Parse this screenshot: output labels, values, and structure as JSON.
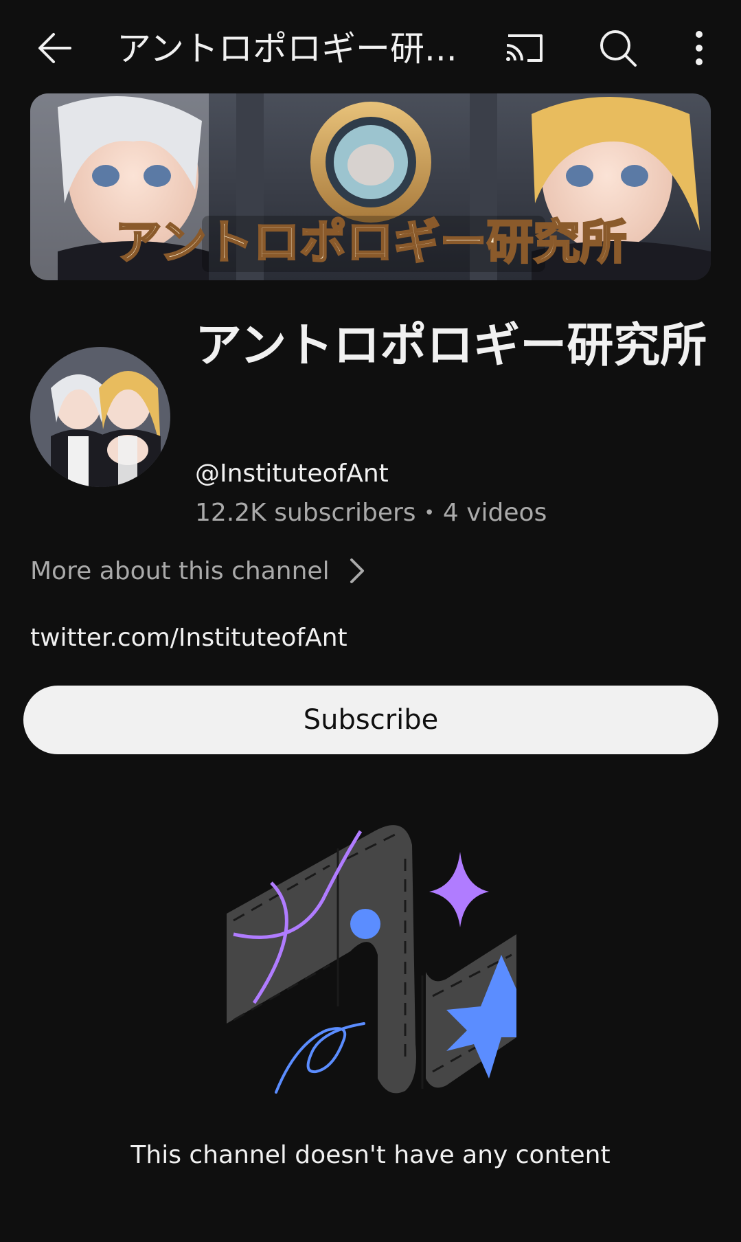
{
  "header": {
    "title": "アントロポロギー研...",
    "back_icon": "arrow-back-icon",
    "cast_icon": "cast-icon",
    "search_icon": "search-icon",
    "more_icon": "more-vertical-icon"
  },
  "banner": {
    "overlay_text": "アントロポロギー研究所"
  },
  "channel": {
    "name": "アントロポロギー研究所",
    "handle": "@InstituteofAnt",
    "subscribers": "12.2K subscribers",
    "separator": "•",
    "videos": "4 videos",
    "more_about": "More about this channel",
    "link": "twitter.com/InstituteofAnt"
  },
  "actions": {
    "subscribe_label": "Subscribe"
  },
  "empty_state": {
    "message": "This channel doesn't have any content"
  },
  "colors": {
    "background": "#0f0f0f",
    "text_primary": "#f1f1f1",
    "text_secondary": "#aaaaaa",
    "button_bg": "#f1f1f1",
    "accent_purple": "#b07cff",
    "accent_blue": "#5b8dff"
  }
}
